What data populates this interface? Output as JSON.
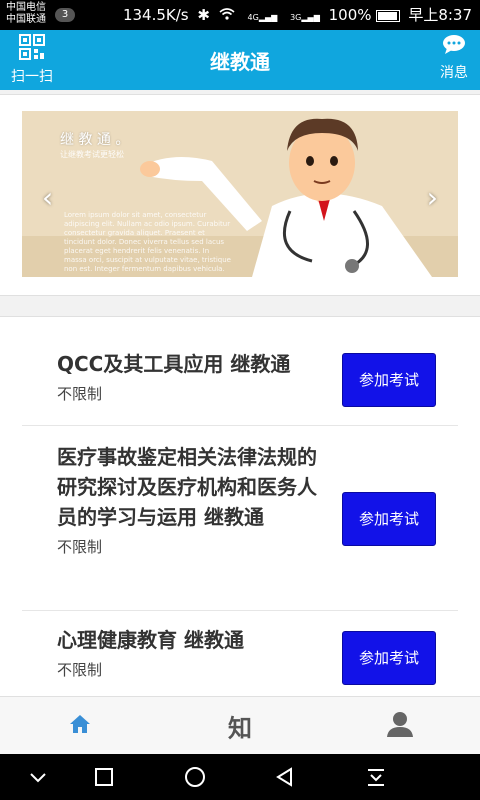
{
  "status_bar": {
    "carrier_1": "中国电信",
    "carrier_2": "中国联通",
    "notification_count": "3",
    "net_speed": "134.5K/s",
    "signal_1": "4G",
    "signal_2": "3G",
    "battery": "100%",
    "time": "早上8:37"
  },
  "header": {
    "title": "继教通",
    "scan_label": "扫一扫",
    "message_label": "消息"
  },
  "banner": {
    "title": "继 教 通 。",
    "subtitle": "让继教考试更轻松",
    "lorem": "Lorem ipsum dolor sit amet, consectetur adipiscing elit. Nullam ac odio ipsum. Curabitur consectetur gravida aliquet. Praesent et tincidunt dolor. Donec viverra tellus sed lacus placerat eget hendrerit felis venenatis. In massa orci, suscipit at vulputate vitae, tristique non est. Integer fermentum dapibus vehicula."
  },
  "courses": [
    {
      "title": "QCC及其工具应用 继教通",
      "limit": "不限制",
      "button": "参加考试"
    },
    {
      "title": "医疗事故鉴定相关法律法规的研究探讨及医疗机构和医务人员的学习与运用 继教通",
      "limit": "不限制",
      "button": "参加考试"
    },
    {
      "title": "心理健康教育 继教通",
      "limit": "不限制",
      "button": "参加考试"
    }
  ],
  "tabbar": {
    "items": [
      {
        "icon": "home-icon",
        "active": true
      },
      {
        "icon": "knowledge-icon",
        "glyph": "知",
        "active": false
      },
      {
        "icon": "user-icon",
        "active": false
      }
    ]
  },
  "colors": {
    "header": "#10a6de",
    "exam_button": "#1212e8",
    "active_tab": "#3a8fd6"
  }
}
